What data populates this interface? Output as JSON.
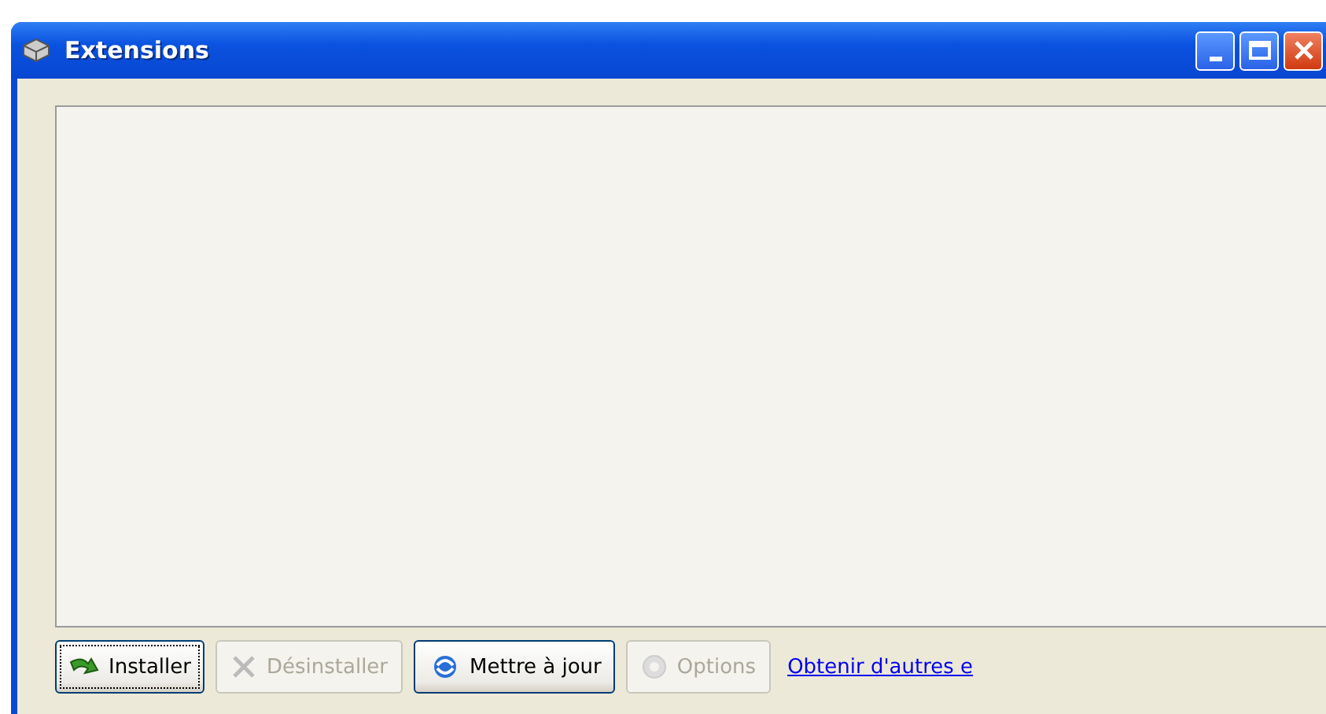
{
  "window": {
    "title": "Extensions"
  },
  "buttons": [
    {
      "label": "Installer",
      "kind": "install",
      "disabled": false,
      "focused": true
    },
    {
      "label": "Désinstaller",
      "kind": "uninstall",
      "disabled": true,
      "focused": false
    },
    {
      "label": "Mettre à jour",
      "kind": "update",
      "disabled": false,
      "focused": false
    },
    {
      "label": "Options",
      "kind": "options",
      "disabled": true,
      "focused": false
    }
  ],
  "link": "Obtenir d'autres e"
}
